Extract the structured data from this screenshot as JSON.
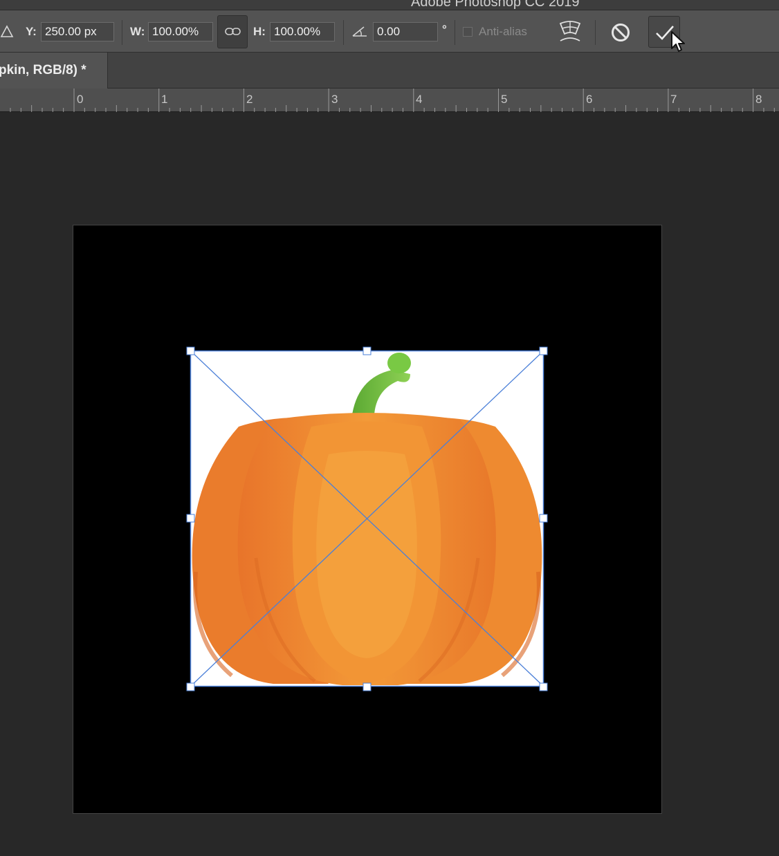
{
  "window": {
    "title": "Adobe Photoshop CC 2019"
  },
  "options_bar": {
    "y_label": "Y:",
    "y_value": "250.00 px",
    "w_label": "W:",
    "w_value": "100.00%",
    "h_label": "H:",
    "h_value": "100.00%",
    "angle_value": "0.00",
    "degree_symbol": "°",
    "anti_alias_label": "Anti-alias",
    "anti_alias_checked": false
  },
  "document_tab": {
    "label": "pkin, RGB/8) *"
  },
  "ruler": {
    "labels": [
      "0",
      "1",
      "2",
      "3",
      "4",
      "5",
      "6",
      "7",
      "8"
    ]
  },
  "colors": {
    "app_background": "#282828",
    "options_bar": "#535353",
    "selection_blue": "#4a7fd8",
    "pumpkin_orange": "#f08a2a",
    "stem_green": "#6fbf3a"
  },
  "icons": [
    "reference-point-triangle-icon",
    "link-chain-icon",
    "rotate-angle-icon",
    "warp-mode-icon",
    "cancel-transform-icon",
    "commit-transform-icon",
    "mouse-cursor-icon"
  ]
}
